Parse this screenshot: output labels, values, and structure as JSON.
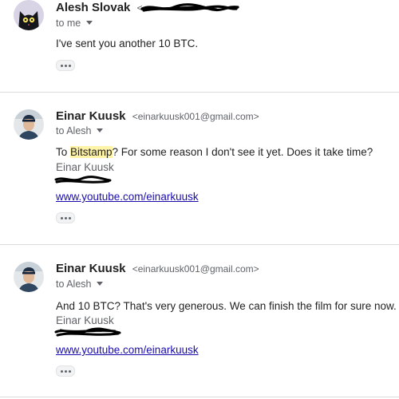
{
  "messages": [
    {
      "sender_name": "Alesh Slovak",
      "email_prefix": "<",
      "to_line": "to me",
      "body": "I've sent you another 10 BTC.",
      "more_icon": "more-horiz-icon"
    },
    {
      "sender_name": "Einar Kuusk",
      "sender_email": "<einarkuusk001@gmail.com>",
      "to_line": "to Alesh",
      "body_pre": "To ",
      "body_highlight": "Bitstamp",
      "body_post": "? For some reason I don't see it yet. Does it take time?",
      "signature_name": "Einar Kuusk",
      "link": "www.youtube.com/einarkuusk",
      "more_icon": "more-horiz-icon"
    },
    {
      "sender_name": "Einar Kuusk",
      "sender_email": "<einarkuusk001@gmail.com>",
      "to_line": "to Alesh",
      "body": "And 10 BTC? That's very generous. We can finish the film for sure now.",
      "signature_name": "Einar Kuusk",
      "link": "www.youtube.com/einarkuusk",
      "more_icon": "more-horiz-icon"
    }
  ],
  "colors": {
    "highlight": "#fff3a8",
    "link": "#1a0dab",
    "secondary_text": "#5f6368",
    "divider": "#dcdcdc"
  }
}
